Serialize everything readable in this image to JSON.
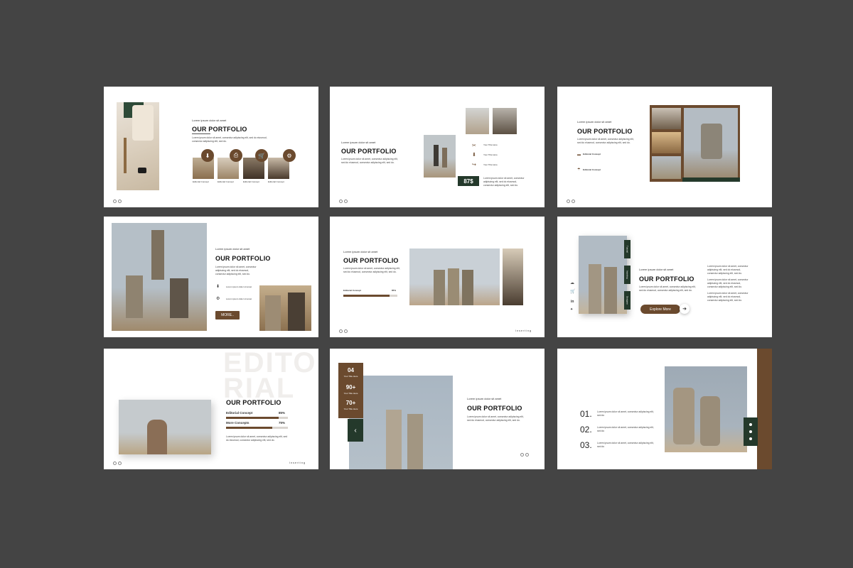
{
  "common": {
    "title": "OUR PORTFOLIO",
    "kicker": "Lorem ipsum dolor sit amet",
    "body": "Lorem ipsum dolor sit amet, consectur adipiscing elit, sed do eiusmod, consectur adipiscing elit, sed do.",
    "brand": "Inserting",
    "title_here": "Your Title Here"
  },
  "slide1": {
    "captions": [
      "Editorial Concept",
      "Editorial Concept",
      "Editorial Concept",
      "Editorial Concept"
    ]
  },
  "slide2": {
    "price": "87$",
    "items": [
      "Your Title Here",
      "Your Title Here",
      "Your Title Here"
    ]
  },
  "slide3": {
    "items": [
      "Editorial Concept",
      "Editorial Concept"
    ]
  },
  "slide4": {
    "button": "MORE..",
    "items": [
      "Lorem ipsum dolor sit amet",
      "Lorem ipsum dolor sit amet"
    ]
  },
  "slide5": {
    "bar_label": "Editorial Concept",
    "bar_value": "85%",
    "bar_fraction": 0.85
  },
  "slide6": {
    "tabs": [
      "Tutorial",
      "Inserting",
      "Designer"
    ],
    "button": "Explore More"
  },
  "slide7": {
    "watermark_1": "EDITO",
    "watermark_2": "RIAL",
    "bars": [
      {
        "label": "Editorial Concept",
        "value": "85%",
        "fraction": 0.85
      },
      {
        "label": "More Concepts",
        "value": "75%",
        "fraction": 0.75
      }
    ]
  },
  "slide8": {
    "stats": [
      {
        "value": "04",
        "label": "Your Title Here"
      },
      {
        "value": "90+",
        "label": "Your Title Here"
      },
      {
        "value": "70+",
        "label": "Your Title Here"
      }
    ]
  },
  "slide9": {
    "items": [
      {
        "num": "01.",
        "text": "Lorem ipsum dolor sit amet, consectur adipiscing elit, sed do"
      },
      {
        "num": "02.",
        "text": "Lorem ipsum dolor sit amet, consectur adipiscing elit, sed do"
      },
      {
        "num": "03.",
        "text": "Lorem ipsum dolor sit amet, consectur adipiscing elit, sed do"
      }
    ]
  },
  "colors": {
    "background": "#444444",
    "accent_brown": "#6b4a2e",
    "accent_green": "#24392b",
    "slide": "#ffffff"
  }
}
